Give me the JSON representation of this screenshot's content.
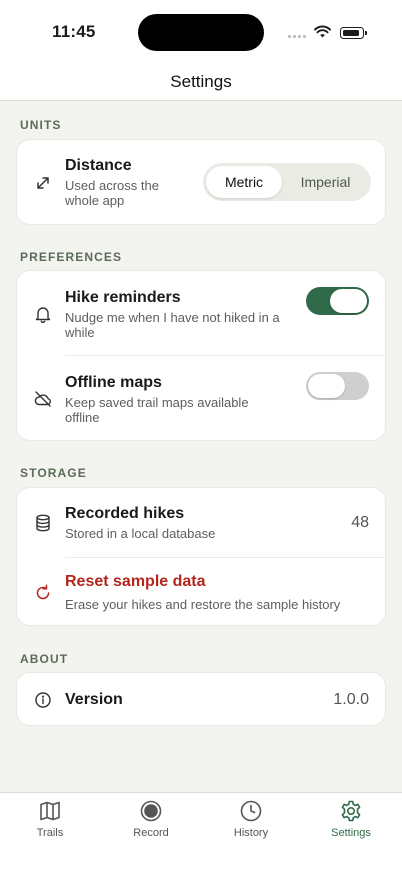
{
  "status": {
    "time": "11:45"
  },
  "nav": {
    "title": "Settings"
  },
  "sections": {
    "units": "UNITS",
    "preferences": "PREFERENCES",
    "storage": "STORAGE",
    "about": "ABOUT"
  },
  "units": {
    "distance": {
      "title": "Distance",
      "subtitle_line1": "Used across the",
      "subtitle_line2": "whole app",
      "icon": "arrows-diagonal-icon",
      "options": [
        "Metric",
        "Imperial"
      ],
      "selected": "Metric"
    }
  },
  "preferences": {
    "reminders": {
      "title": "Hike reminders",
      "subtitle_line1": "Nudge me when I have not hiked in a",
      "subtitle_line2": "while",
      "icon": "bell-icon",
      "enabled": true
    },
    "offline": {
      "title": "Offline maps",
      "subtitle_line1": "Keep saved trail maps available",
      "subtitle_line2": "offline",
      "icon": "cloud-off-icon",
      "enabled": false
    }
  },
  "storage": {
    "recorded": {
      "title": "Recorded hikes",
      "subtitle": "Stored in a local database",
      "count": "48",
      "icon": "database-icon"
    },
    "reset": {
      "title": "Reset sample data",
      "subtitle": "Erase your hikes and restore the sample history",
      "icon": "refresh-icon"
    }
  },
  "about": {
    "version": {
      "title": "Version",
      "value": "1.0.0",
      "icon": "info-icon"
    }
  },
  "tabs": [
    {
      "label": "Trails",
      "icon": "map-icon"
    },
    {
      "label": "Record",
      "icon": "record-icon"
    },
    {
      "label": "History",
      "icon": "clock-icon"
    },
    {
      "label": "Settings",
      "icon": "gear-icon"
    }
  ],
  "colors": {
    "accent": "#2f6b49",
    "danger": "#b3261e",
    "background": "#f3f3ef",
    "section_title": "#5c6b58"
  }
}
